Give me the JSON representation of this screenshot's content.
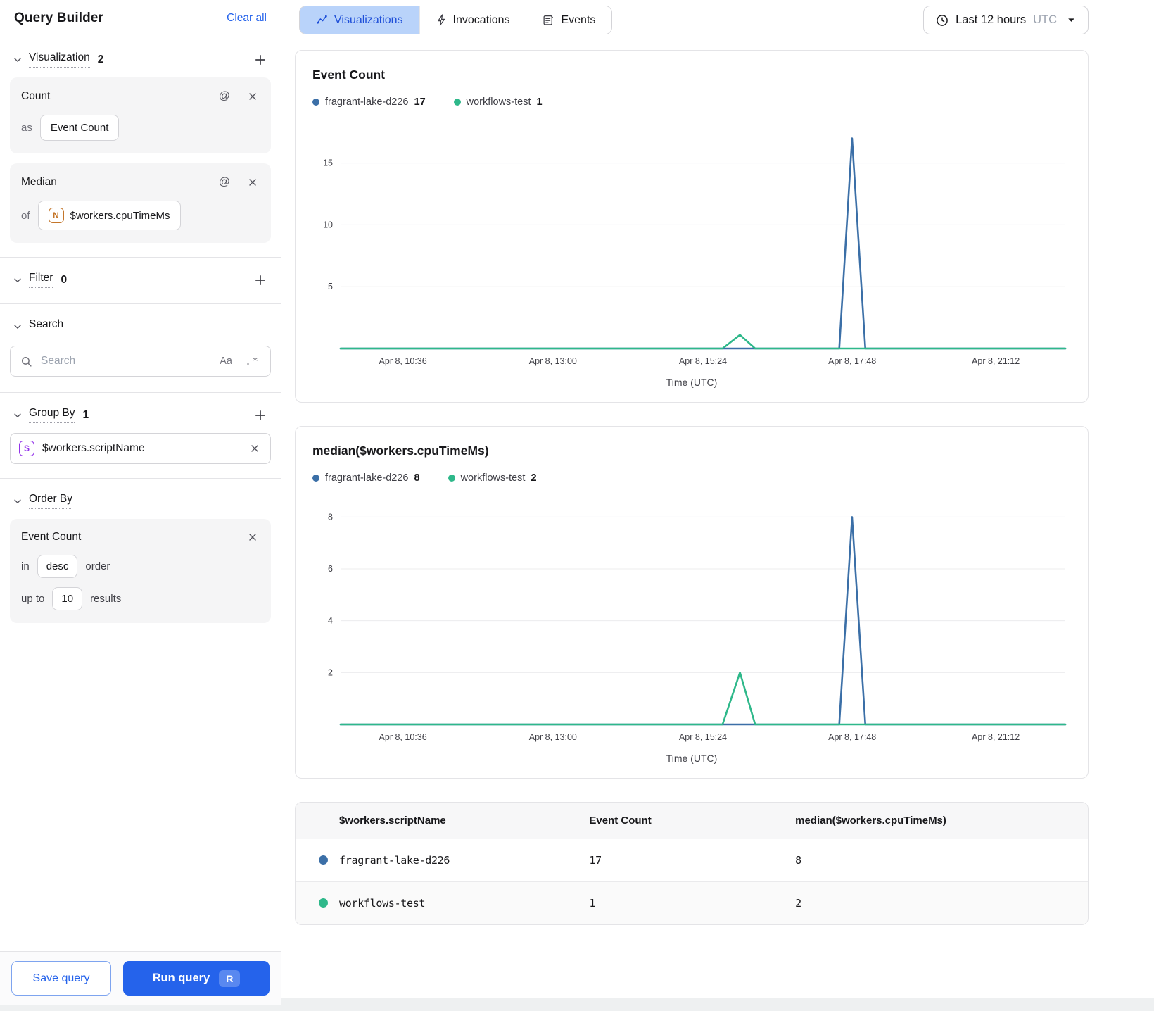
{
  "icons": {
    "at": "@",
    "case_sensitive": "Aa",
    "regex": ".*"
  },
  "colors": {
    "accent": "#2563eb",
    "series_blue": "#3b6fa7",
    "series_green": "#2eb88a",
    "tab_active_bg": "#b9d3fa"
  },
  "sidebar": {
    "title": "Query Builder",
    "clear_all": "Clear all",
    "visualization": {
      "label": "Visualization",
      "count": "2",
      "count_card": {
        "title": "Count",
        "as_label": "as",
        "value": "Event Count"
      },
      "median_card": {
        "title": "Median",
        "of_label": "of",
        "icon_letter": "N",
        "value": "$workers.cpuTimeMs"
      }
    },
    "filter": {
      "label": "Filter",
      "count": "0"
    },
    "search": {
      "label": "Search",
      "placeholder": "Search"
    },
    "group_by": {
      "label": "Group By",
      "count": "1",
      "icon_letter": "S",
      "field": "$workers.scriptName"
    },
    "order_by": {
      "label": "Order By",
      "card": {
        "title": "Event Count",
        "in_label": "in",
        "direction": "desc",
        "order_label": "order",
        "upto_label": "up to",
        "limit": "10",
        "results_label": "results"
      }
    },
    "footer": {
      "save_label": "Save query",
      "run_label": "Run query",
      "run_shortcut": "R"
    }
  },
  "topbar": {
    "tabs": [
      {
        "label": "Visualizations",
        "active": true
      },
      {
        "label": "Invocations",
        "active": false
      },
      {
        "label": "Events",
        "active": false
      }
    ],
    "time_range": {
      "label": "Last 12 hours",
      "zone": "UTC"
    }
  },
  "chart_data": [
    {
      "type": "line",
      "title": "Event Count",
      "xlabel": "Time (UTC)",
      "x_ticks": [
        "Apr 8, 10:36",
        "Apr 8, 13:00",
        "Apr 8, 15:24",
        "Apr 8, 17:48",
        "Apr 8, 21:12"
      ],
      "x_tick_fractions": [
        0.086,
        0.293,
        0.5,
        0.706,
        0.904
      ],
      "y_ticks": [
        5,
        10,
        15
      ],
      "ylim": [
        0,
        17.2
      ],
      "grid": true,
      "legend_position": "top",
      "series": [
        {
          "name": "fragrant-lake-d226",
          "display_value": "17",
          "color": "#3b6fa7",
          "points": [
            [
              0,
              0
            ],
            [
              0.688,
              0
            ],
            [
              0.7057,
              17
            ],
            [
              0.724,
              0
            ],
            [
              1,
              0
            ]
          ]
        },
        {
          "name": "workflows-test",
          "display_value": "1",
          "color": "#2eb88a",
          "points": [
            [
              0,
              0
            ],
            [
              0.527,
              0
            ],
            [
              0.551,
              1.1
            ],
            [
              0.572,
              0
            ],
            [
              1,
              0
            ]
          ]
        }
      ]
    },
    {
      "type": "line",
      "title": "median($workers.cpuTimeMs)",
      "xlabel": "Time (UTC)",
      "x_ticks": [
        "Apr 8, 10:36",
        "Apr 8, 13:00",
        "Apr 8, 15:24",
        "Apr 8, 17:48",
        "Apr 8, 21:12"
      ],
      "x_tick_fractions": [
        0.086,
        0.293,
        0.5,
        0.706,
        0.904
      ],
      "y_ticks": [
        2,
        4,
        6,
        8
      ],
      "ylim": [
        0,
        8.2
      ],
      "grid": true,
      "legend_position": "top",
      "series": [
        {
          "name": "fragrant-lake-d226",
          "display_value": "8",
          "color": "#3b6fa7",
          "points": [
            [
              0,
              0
            ],
            [
              0.688,
              0
            ],
            [
              0.7057,
              8
            ],
            [
              0.724,
              0
            ],
            [
              1,
              0
            ]
          ]
        },
        {
          "name": "workflows-test",
          "display_value": "2",
          "color": "#2eb88a",
          "points": [
            [
              0,
              0
            ],
            [
              0.527,
              0
            ],
            [
              0.551,
              2
            ],
            [
              0.572,
              0
            ],
            [
              1,
              0
            ]
          ]
        }
      ]
    }
  ],
  "table": {
    "headers": [
      "$workers.scriptName",
      "Event Count",
      "median($workers.cpuTimeMs)"
    ],
    "rows": [
      {
        "dot_color": "#3b6fa7",
        "cells": [
          "fragrant-lake-d226",
          "17",
          "8"
        ]
      },
      {
        "dot_color": "#2eb88a",
        "cells": [
          "workflows-test",
          "1",
          "2"
        ]
      }
    ]
  }
}
